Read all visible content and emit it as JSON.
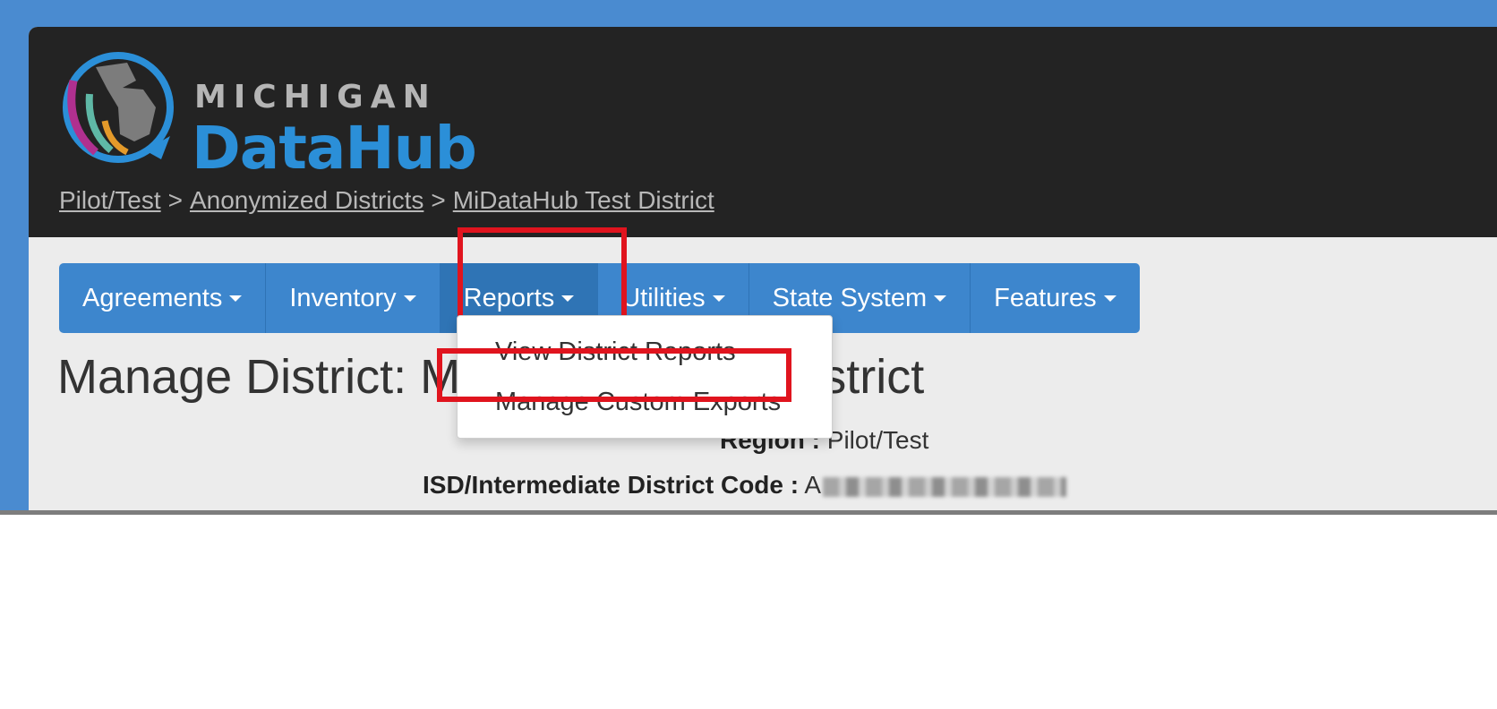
{
  "logo": {
    "top_text": "MICHIGAN",
    "bottom_text_a": "Data",
    "bottom_text_b": "Hub",
    "mark_icon": "michigan-map-arrows-icon"
  },
  "breadcrumb": {
    "items": [
      "Pilot/Test",
      "Anonymized Districts",
      "MiDataHub Test District"
    ],
    "separator": ">"
  },
  "nav": {
    "items": [
      {
        "label": "Agreements"
      },
      {
        "label": "Inventory"
      },
      {
        "label": "Reports"
      },
      {
        "label": "Utilities"
      },
      {
        "label": "State System"
      },
      {
        "label": "Features"
      }
    ]
  },
  "reports_menu": {
    "items": [
      "View District Reports",
      "Manage Custom Exports"
    ]
  },
  "page": {
    "title": "Manage District: MiDataHub Test District",
    "fields": [
      {
        "label": "Region :",
        "value": "Pilot/Test"
      },
      {
        "label": "ISD/Intermediate District Code :",
        "value": "A"
      }
    ]
  },
  "colors": {
    "frame": "#4a8bd0",
    "header": "#232323",
    "nav": "#3d86cd",
    "highlight": "#e0141e",
    "brand_blue": "#2b8fd8"
  }
}
